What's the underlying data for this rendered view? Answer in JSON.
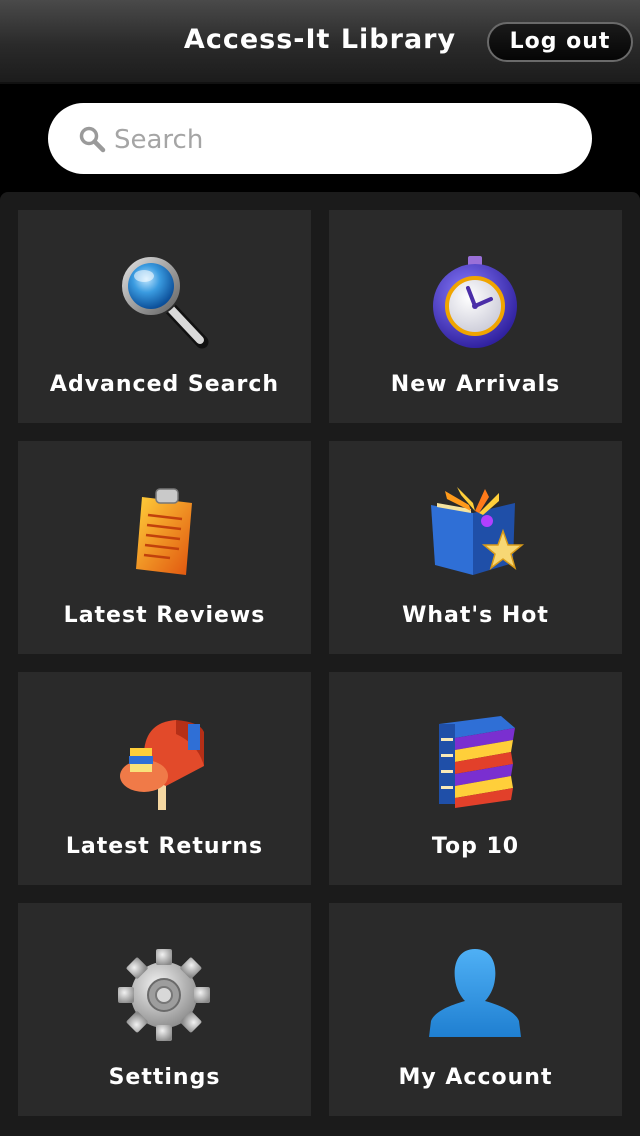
{
  "header": {
    "title": "Access-It Library",
    "logout_label": "Log out"
  },
  "search": {
    "placeholder": "Search",
    "value": "",
    "icon": "search-icon"
  },
  "tiles": [
    {
      "label": "Advanced Search",
      "icon": "magnifying-glass-icon"
    },
    {
      "label": "New Arrivals",
      "icon": "stopwatch-icon"
    },
    {
      "label": "Latest Reviews",
      "icon": "clipboard-icon"
    },
    {
      "label": "What's Hot",
      "icon": "book-star-icon"
    },
    {
      "label": "Latest Returns",
      "icon": "mailbox-icon"
    },
    {
      "label": "Top 10",
      "icon": "book-stack-icon"
    },
    {
      "label": "Settings",
      "icon": "gear-icon"
    },
    {
      "label": "My Account",
      "icon": "user-silhouette-icon"
    }
  ],
  "colors": {
    "background": "#000000",
    "tile": "#2a2a2a",
    "panel": "#1b1b1b",
    "text": "#ffffff"
  }
}
